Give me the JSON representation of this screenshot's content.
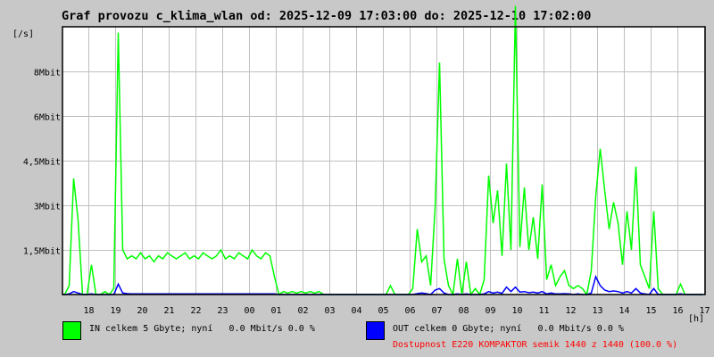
{
  "chart_data": {
    "type": "line",
    "title": "Graf provozu c_klima_wlan od: 2025-12-09 17:03:00 do: 2025-12-10 17:02:00",
    "ylabel": "[/s]",
    "xlabel": "[h]",
    "ylim": [
      0,
      9
    ],
    "y_unit": "Mbit/s",
    "y_ticks": [
      {
        "value": 1.5,
        "label": "1,5Mbit"
      },
      {
        "value": 3,
        "label": "3Mbit"
      },
      {
        "value": 4.5,
        "label": "4,5Mbit"
      },
      {
        "value": 6,
        "label": "6Mbit"
      },
      {
        "value": 7.5,
        "label": "8Mbit"
      }
    ],
    "x_start_minute": 1023,
    "x_span_minutes": 1440,
    "bin_minutes": 10,
    "x_ticks": [
      "18",
      "19",
      "20",
      "21",
      "22",
      "23",
      "00",
      "01",
      "02",
      "03",
      "04",
      "05",
      "06",
      "07",
      "08",
      "09",
      "10",
      "11",
      "12",
      "13",
      "14",
      "15",
      "16",
      "17"
    ],
    "grid": true,
    "series": [
      {
        "name": "IN",
        "color": "#00ff00",
        "values": [
          0,
          0.3,
          3.9,
          2.5,
          0,
          0,
          1.0,
          0,
          0,
          0.1,
          0,
          0.2,
          8.8,
          1.5,
          1.2,
          1.3,
          1.2,
          1.4,
          1.2,
          1.3,
          1.1,
          1.3,
          1.2,
          1.4,
          1.3,
          1.2,
          1.3,
          1.4,
          1.2,
          1.3,
          1.2,
          1.4,
          1.3,
          1.2,
          1.3,
          1.5,
          1.2,
          1.3,
          1.2,
          1.4,
          1.3,
          1.2,
          1.5,
          1.3,
          1.2,
          1.4,
          1.3,
          0.6,
          0,
          0.1,
          0.05,
          0.1,
          0.05,
          0.1,
          0.05,
          0.1,
          0.05,
          0.1,
          0,
          0,
          0,
          0,
          0,
          0,
          0,
          0,
          0,
          0,
          0,
          0,
          0,
          0,
          0,
          0.3,
          0,
          0,
          0,
          0,
          0.2,
          2.2,
          1.1,
          1.3,
          0.3,
          2.9,
          7.8,
          1.2,
          0.3,
          0,
          1.2,
          0,
          1.1,
          0,
          0.2,
          0,
          0.5,
          4.0,
          2.4,
          3.5,
          1.3,
          4.4,
          1.5,
          9.7,
          1.6,
          3.6,
          1.5,
          2.6,
          1.2,
          3.7,
          0.5,
          1.0,
          0.3,
          0.6,
          0.8,
          0.3,
          0.2,
          0.3,
          0.2,
          0,
          0.8,
          3.3,
          4.9,
          3.5,
          2.2,
          3.1,
          2.4,
          1.0,
          2.8,
          1.5,
          4.3,
          1.0,
          0.6,
          0.2,
          2.8,
          0.2,
          0,
          0,
          0,
          0,
          0.35,
          0,
          0,
          0,
          0,
          0
        ]
      },
      {
        "name": "OUT",
        "color": "#0000ff",
        "values": [
          0,
          0.02,
          0.1,
          0.05,
          0,
          0,
          0.02,
          0,
          0,
          0,
          0,
          0,
          0.35,
          0.05,
          0.03,
          0.02,
          0.02,
          0.02,
          0.02,
          0.02,
          0.02,
          0.02,
          0.02,
          0.02,
          0.02,
          0.02,
          0.02,
          0.02,
          0.02,
          0.02,
          0.02,
          0.02,
          0.02,
          0.02,
          0.02,
          0.02,
          0.02,
          0.02,
          0.02,
          0.02,
          0.02,
          0.02,
          0.02,
          0.02,
          0.02,
          0.02,
          0.02,
          0.02,
          0,
          0,
          0,
          0,
          0,
          0,
          0,
          0,
          0,
          0,
          0,
          0,
          0,
          0,
          0,
          0,
          0,
          0,
          0,
          0,
          0,
          0,
          0,
          0,
          0,
          0,
          0,
          0,
          0,
          0,
          0,
          0.03,
          0.05,
          0.03,
          0,
          0.15,
          0.2,
          0.05,
          0,
          0,
          0.02,
          0,
          0.02,
          0,
          0,
          0,
          0.02,
          0.1,
          0.05,
          0.08,
          0.04,
          0.25,
          0.1,
          0.25,
          0.08,
          0.1,
          0.06,
          0.08,
          0.05,
          0.1,
          0.02,
          0.05,
          0.02,
          0.02,
          0.03,
          0.02,
          0,
          0.02,
          0,
          0,
          0.05,
          0.6,
          0.3,
          0.15,
          0.1,
          0.12,
          0.1,
          0.05,
          0.1,
          0.05,
          0.2,
          0.05,
          0.02,
          0,
          0.2,
          0,
          0,
          0,
          0,
          0,
          0.02,
          0,
          0,
          0,
          0,
          0
        ]
      }
    ]
  },
  "legend": {
    "in_text": "IN celkem 5 Gbyte; nyní   0.0 Mbit/s 0.0 %",
    "out_text": "OUT celkem 0 Gbyte; nyní   0.0 Mbit/s 0.0 %",
    "availability": "Dostupnost E220 KOMPAKTOR semik 1440 z 1440 (100.0 %)"
  }
}
